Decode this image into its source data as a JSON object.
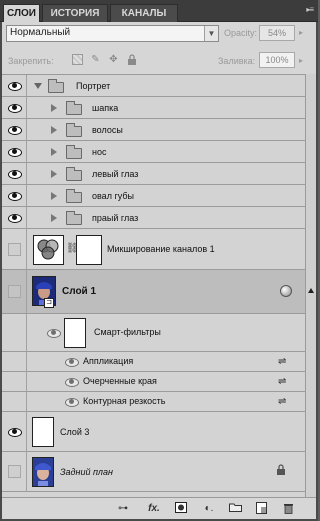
{
  "tabs": [
    {
      "label": "СЛОИ",
      "active": true
    },
    {
      "label": "ИСТОРИЯ",
      "active": false
    },
    {
      "label": "КАНАЛЫ",
      "active": false
    }
  ],
  "panel_menu_glyph": "▸≡",
  "blend_mode": "Нормальный",
  "opacity_label": "Opacity:",
  "opacity_value": "54%",
  "lock_label": "Закрепить:",
  "fill_label": "Заливка:",
  "fill_value": "100%",
  "layers": {
    "group_main": "Портрет",
    "subgroups": [
      "шапка",
      "волосы",
      "нос",
      "левый глаз",
      "овал губы",
      "праый глаз"
    ],
    "channel_mixer": "Микширование каналов 1",
    "layer1": "Слой 1",
    "smart_filters": "Смарт-фильтры",
    "filters": [
      "Аппликация",
      "Очерченные края",
      "Контурная резкость"
    ],
    "layer3": "Слой 3",
    "background": "Задний план"
  },
  "bottom_bar": {
    "link_glyph": "⊶",
    "fx_label": "fx.",
    "adjust_glyph": "◐."
  },
  "colors": {
    "panel_bg": "#d3d3d3",
    "selected_row": "#bdbdbd",
    "tab_active": "#d6d6d6"
  }
}
